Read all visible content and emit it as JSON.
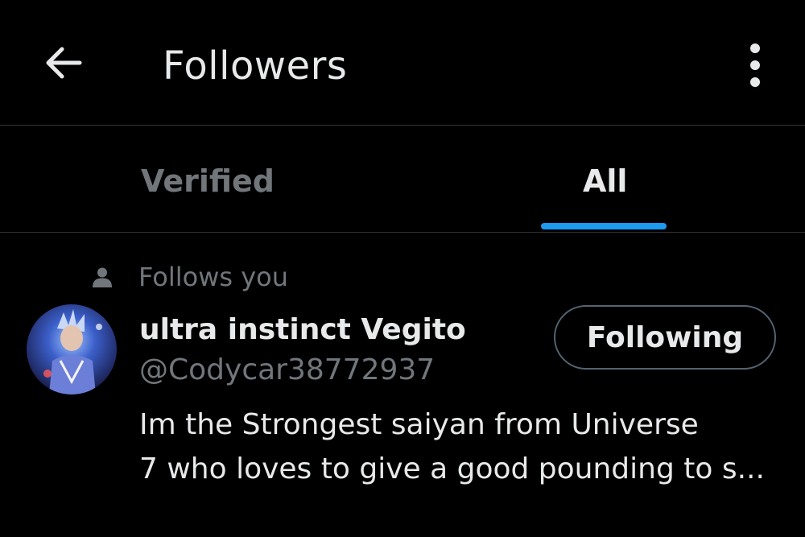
{
  "header": {
    "title": "Followers",
    "back_icon": "arrow-left-icon",
    "more_icon": "more-vertical-icon"
  },
  "tabs": [
    {
      "label": "Verified",
      "active": false
    },
    {
      "label": "All",
      "active": true
    }
  ],
  "colors": {
    "background": "#000000",
    "primary_text": "#e7e9ea",
    "secondary_text": "#71767b",
    "divider": "#2f3336",
    "accent": "#1d9bf0",
    "button_border": "#536471"
  },
  "followers": [
    {
      "follows_you_label": "Follows you",
      "display_name": "ultra instinct Vegito",
      "handle": "@Codycar38772937",
      "follow_button_label": "Following",
      "bio_lines": [
        "Im the Strongest saiyan from Universe",
        "7 who loves to give a good pounding to s..."
      ]
    }
  ]
}
